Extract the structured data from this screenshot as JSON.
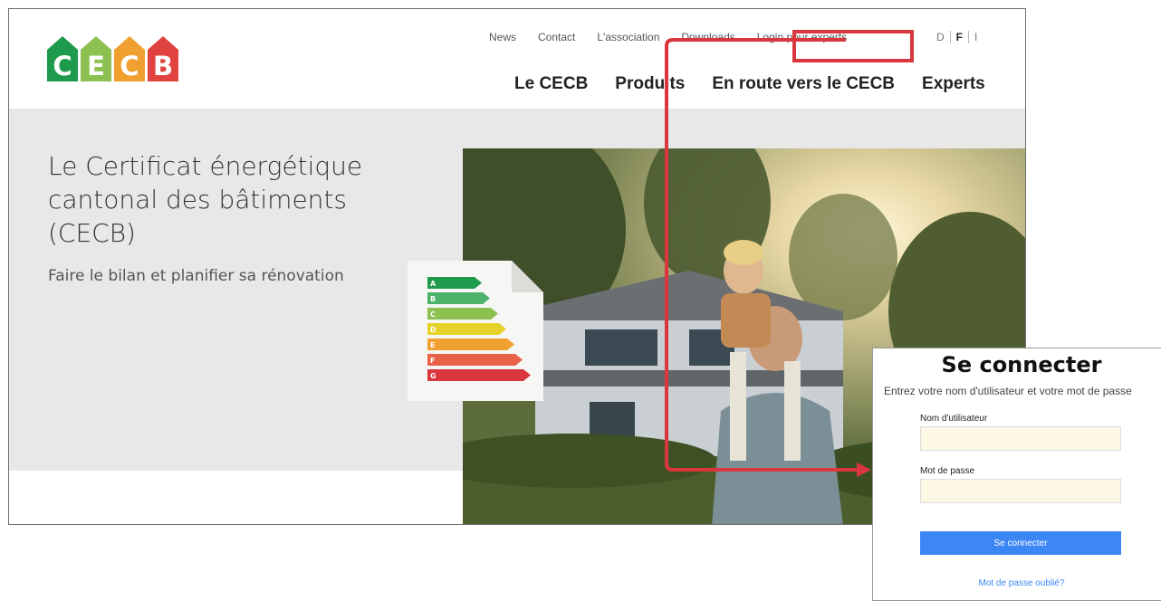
{
  "logo": {
    "letters": [
      {
        "char": "C",
        "color": "#1e9a4c"
      },
      {
        "char": "E",
        "color": "#8cc152"
      },
      {
        "char": "C",
        "color": "#f0a030"
      },
      {
        "char": "B",
        "color": "#e0433f"
      }
    ]
  },
  "util_nav": [
    "News",
    "Contact",
    "L'association",
    "Downloads"
  ],
  "login_link": "Login pour experts",
  "languages": [
    "D",
    "F",
    "I"
  ],
  "active_language": "F",
  "main_nav": [
    "Le CECB",
    "Produits",
    "En route vers le CECB",
    "Experts"
  ],
  "hero": {
    "title": "Le Certificat énergétique cantonal des bâtiments (CECB)",
    "subtitle": "Faire le bilan et planifier sa rénovation"
  },
  "energy_classes": [
    {
      "letter": "A",
      "color": "#1e9a4c"
    },
    {
      "letter": "B",
      "color": "#4cb26a"
    },
    {
      "letter": "C",
      "color": "#8cc152"
    },
    {
      "letter": "D",
      "color": "#e6d22a"
    },
    {
      "letter": "E",
      "color": "#f0a030"
    },
    {
      "letter": "F",
      "color": "#e8624a"
    },
    {
      "letter": "G",
      "color": "#d9363e"
    }
  ],
  "login_panel": {
    "title": "Se connecter",
    "description": "Entrez votre nom d'utilisateur et votre mot de passe",
    "username_label": "Nom d'utilisateur",
    "password_label": "Mot de passe",
    "submit_label": "Se connecter",
    "forgot_label": "Mot de passe oublié?"
  },
  "colors": {
    "annotation_red": "#d9363e",
    "button_blue": "#3d87f5",
    "input_fill": "#fdf8e6"
  }
}
